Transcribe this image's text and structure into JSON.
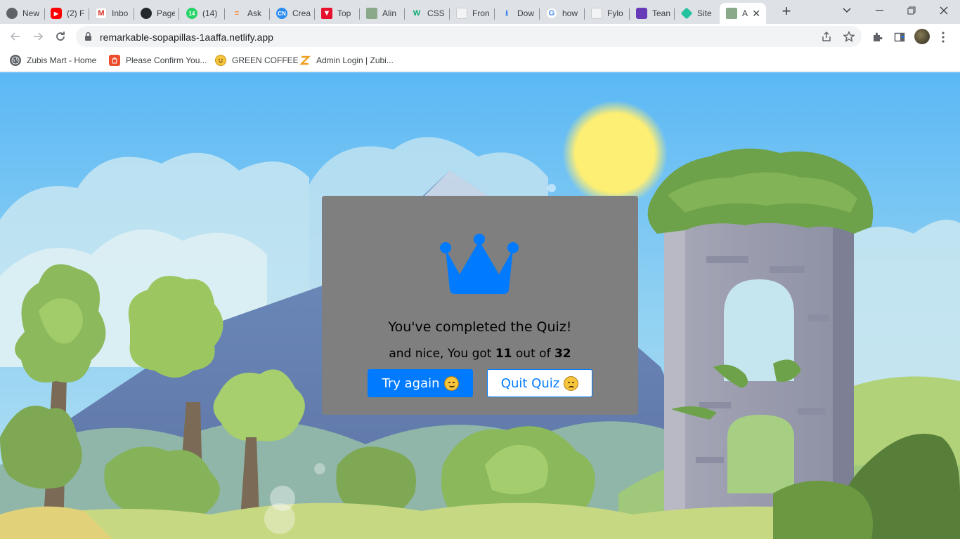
{
  "browser": {
    "tabs": [
      {
        "title": "New",
        "icon": "chrome-icon"
      },
      {
        "title": "(2) F",
        "icon": "youtube-icon"
      },
      {
        "title": "Inbo",
        "icon": "gmail-icon"
      },
      {
        "title": "Page",
        "icon": "github-icon"
      },
      {
        "title": "(14)",
        "icon": "whatsapp-icon"
      },
      {
        "title": "Ask",
        "icon": "stackoverflow-icon"
      },
      {
        "title": "Crea",
        "icon": "codingninjas-icon"
      },
      {
        "title": "Top",
        "icon": "topmate-icon"
      },
      {
        "title": "Alin",
        "icon": "image-icon"
      },
      {
        "title": "CSS",
        "icon": "w3schools-icon"
      },
      {
        "title": "Fron",
        "icon": "page-icon"
      },
      {
        "title": "Dow",
        "icon": "download-icon"
      },
      {
        "title": "how",
        "icon": "google-icon"
      },
      {
        "title": "Fylo",
        "icon": "page-icon"
      },
      {
        "title": "Tean",
        "icon": "forms-icon"
      },
      {
        "title": "Site",
        "icon": "netlify-icon"
      },
      {
        "title": "A",
        "icon": "image-icon",
        "active": true
      }
    ],
    "url": "remarkable-sopapillas-1aaffa.netlify.app",
    "bookmarks": [
      {
        "label": "Zubis Mart - Home",
        "icon": "globe-icon"
      },
      {
        "label": "Please Confirm You...",
        "icon": "shop-icon"
      },
      {
        "label": "GREEN COFFEE",
        "icon": "emoji-icon"
      },
      {
        "label": "Admin Login | Zubi...",
        "icon": "logo-icon"
      }
    ]
  },
  "quiz": {
    "complete_text": "You've completed the Quiz!",
    "score_prefix": "and nice, You got",
    "score": "11",
    "score_mid": "out of",
    "total": "32",
    "try_again_label": "Try again",
    "quit_label": "Quit Quiz"
  },
  "colors": {
    "accent": "#007bff",
    "card": "#7f7f7f"
  }
}
